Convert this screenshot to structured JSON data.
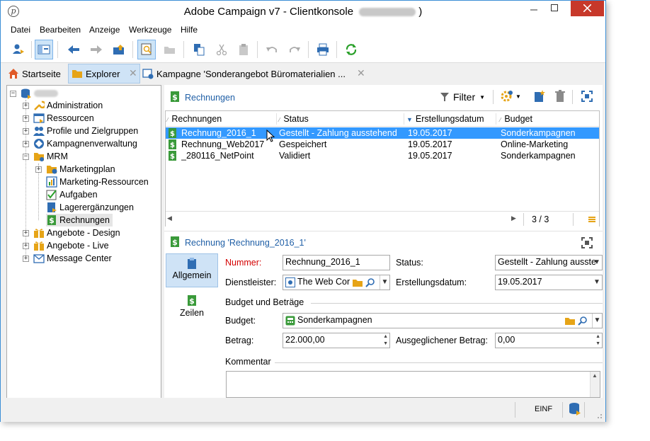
{
  "window": {
    "title": "Adobe Campaign v7 - Clientkonsole",
    "title_suffix": ")"
  },
  "menu": [
    "Datei",
    "Bearbeiten",
    "Anzeige",
    "Werkzeuge",
    "Hilfe"
  ],
  "tabs": [
    {
      "label": "Startseite"
    },
    {
      "label": "Explorer"
    },
    {
      "label": "Kampagne 'Sonderangebot Büromaterialien ..."
    }
  ],
  "tree": {
    "items": [
      {
        "label": "Administration"
      },
      {
        "label": "Ressourcen"
      },
      {
        "label": "Profile und Zielgruppen"
      },
      {
        "label": "Kampagnenverwaltung"
      },
      {
        "label": "MRM"
      },
      {
        "label": "Marketingplan"
      },
      {
        "label": "Marketing-Ressourcen"
      },
      {
        "label": "Aufgaben"
      },
      {
        "label": "Lagerergänzungen"
      },
      {
        "label": "Rechnungen"
      },
      {
        "label": "Angebote - Design"
      },
      {
        "label": "Angebote - Live"
      },
      {
        "label": "Message Center"
      }
    ]
  },
  "list": {
    "title": "Rechnungen",
    "filter_label": "Filter",
    "columns": [
      "Rechnungen",
      "Status",
      "Erstellungsdatum",
      "Budget"
    ],
    "rows": [
      {
        "name": "Rechnung_2016_1",
        "status": "Gestellt - Zahlung ausstehend",
        "date": "19.05.2017",
        "budget": "Sonderkampagnen"
      },
      {
        "name": "Rechnung_Web2017",
        "status": "Gespeichert",
        "date": "19.05.2017",
        "budget": "Online-Marketing"
      },
      {
        "name": "_280116_NetPoint",
        "status": "Validiert",
        "date": "19.05.2017",
        "budget": "Sonderkampagnen"
      }
    ],
    "count": "3 / 3"
  },
  "detail": {
    "title": "Rechnung 'Rechnung_2016_1'",
    "nav": [
      {
        "label": "Allgemein"
      },
      {
        "label": "Zeilen"
      }
    ],
    "fields": {
      "nummer_label": "Nummer:",
      "nummer_value": "Rechnung_2016_1",
      "status_label": "Status:",
      "status_value": "Gestellt - Zahlung ausste",
      "dienstleister_label": "Dienstleister:",
      "dienstleister_value": "The Web Cor",
      "erstellungsdatum_label": "Erstellungsdatum:",
      "erstellungsdatum_value": "19.05.2017",
      "group_label": "Budget und Beträge",
      "budget_label": "Budget:",
      "budget_value": "Sonderkampagnen",
      "betrag_label": "Betrag:",
      "betrag_value": "22.000,00",
      "ausgeglichener_label": "Ausgeglichener Betrag:",
      "ausgeglichener_value": "0,00",
      "kommentar_label": "Kommentar"
    }
  },
  "statusbar": {
    "mode": "EINF"
  },
  "colors": {
    "accent": "#3399ff",
    "title_blue": "#1f5fa6",
    "close_red": "#c7382a",
    "required_red": "#d40000"
  }
}
